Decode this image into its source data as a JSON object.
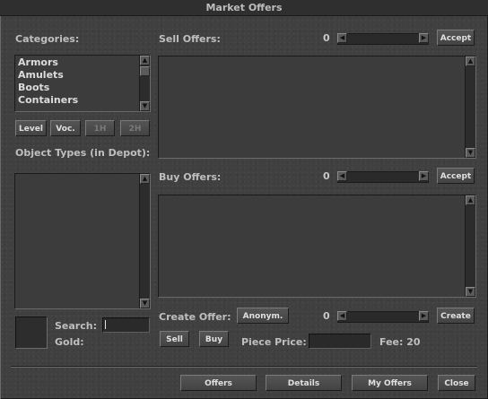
{
  "window": {
    "title": "Market Offers"
  },
  "categories": {
    "label": "Categories:",
    "items": [
      "Armors",
      "Amulets",
      "Boots",
      "Containers"
    ]
  },
  "filters": {
    "level": "Level",
    "voc": "Voc.",
    "one_hand": "1H",
    "two_hand": "2H"
  },
  "object_types": {
    "label": "Object Types (in Depot):"
  },
  "search": {
    "label": "Search:",
    "value": ""
  },
  "gold": {
    "label": "Gold:"
  },
  "sell_offers": {
    "label": "Sell Offers:",
    "amount": "0",
    "accept": "Accept"
  },
  "buy_offers": {
    "label": "Buy Offers:",
    "amount": "0",
    "accept": "Accept"
  },
  "create_offer": {
    "label": "Create Offer:",
    "anonymous": "Anonym.",
    "amount": "0",
    "create": "Create",
    "sell": "Sell",
    "buy": "Buy",
    "piece_price_label": "Piece Price:",
    "piece_price": "",
    "fee": "Fee: 20"
  },
  "footer": {
    "offers": "Offers",
    "details": "Details",
    "my_offers": "My Offers",
    "close": "Close"
  }
}
